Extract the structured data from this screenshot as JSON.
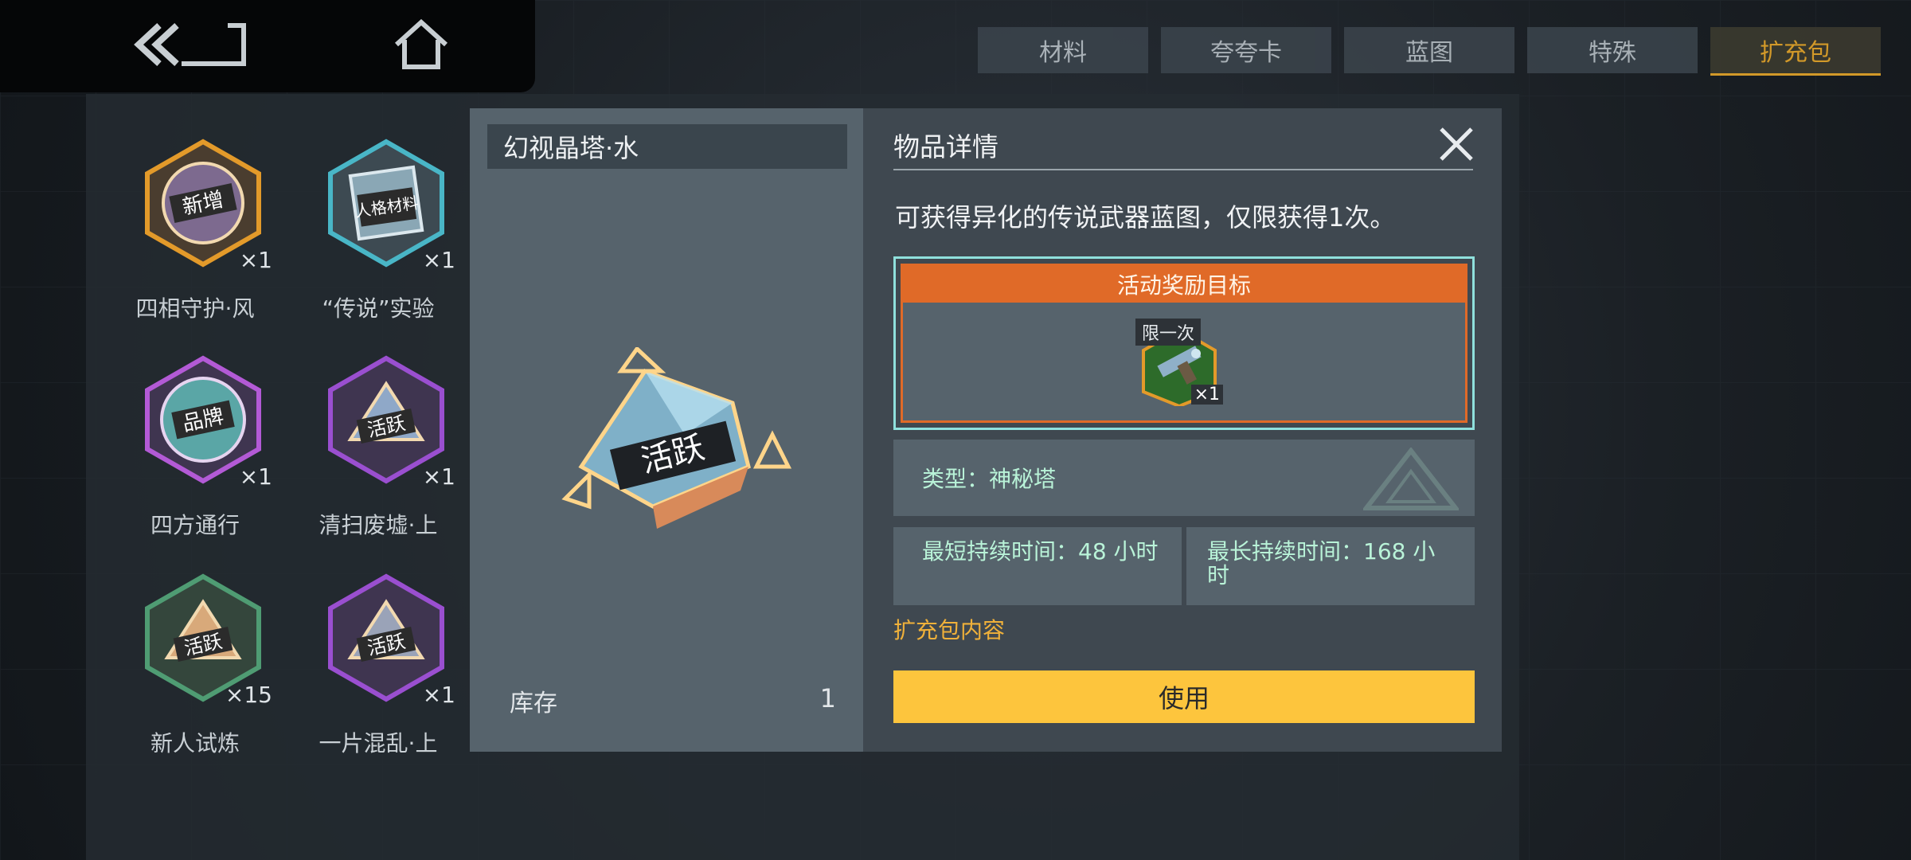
{
  "nav": {
    "back_icon": "double-chevron-back-icon",
    "home_icon": "home-icon"
  },
  "tabs": [
    {
      "label": "材料",
      "active": false
    },
    {
      "label": "夸夸卡",
      "active": false
    },
    {
      "label": "蓝图",
      "active": false
    },
    {
      "label": "特殊",
      "active": false
    },
    {
      "label": "扩充包",
      "active": true
    }
  ],
  "inventory": [
    {
      "label": "四相守护·风",
      "count": "×1",
      "badge": "新增",
      "color": "#e39a2a"
    },
    {
      "label": "“传说”实验",
      "count": "×1",
      "badge": "人格材料",
      "color": "#49b6c7"
    },
    {
      "label": "四方通行",
      "count": "×1",
      "badge": "品牌",
      "color": "#b35ad6"
    },
    {
      "label": "清扫废墟·上",
      "count": "×1",
      "badge": "活跃",
      "color": "#9a4fd0"
    },
    {
      "label": "新人试炼",
      "count": "×15",
      "badge": "活跃",
      "color": "#4f9c73"
    },
    {
      "label": "一片混乱·上",
      "count": "×1",
      "badge": "活跃",
      "color": "#9a4fd0"
    }
  ],
  "detail_left": {
    "title": "幻视晶塔·水",
    "art_badge": "活跃",
    "stock_label": "库存",
    "stock_value": "1"
  },
  "detail_right": {
    "title": "物品详情",
    "description": "可获得异化的传说武器蓝图，仅限获得1次。",
    "reward": {
      "header": "活动奖励目标",
      "tag": "限一次",
      "count": "×1"
    },
    "type_text": "类型：神秘塔",
    "min_duration": "最短持续时间：48 小时",
    "max_duration": "最长持续时间：168 小时",
    "pack_contents_link": "扩充包内容",
    "use_button": "使用"
  },
  "colors": {
    "accent": "#fdc53d",
    "orange": "#e06a28",
    "teal_border": "#8fe0dc",
    "info_text": "#b9f3d8",
    "tab_active": "#e7a72a"
  }
}
